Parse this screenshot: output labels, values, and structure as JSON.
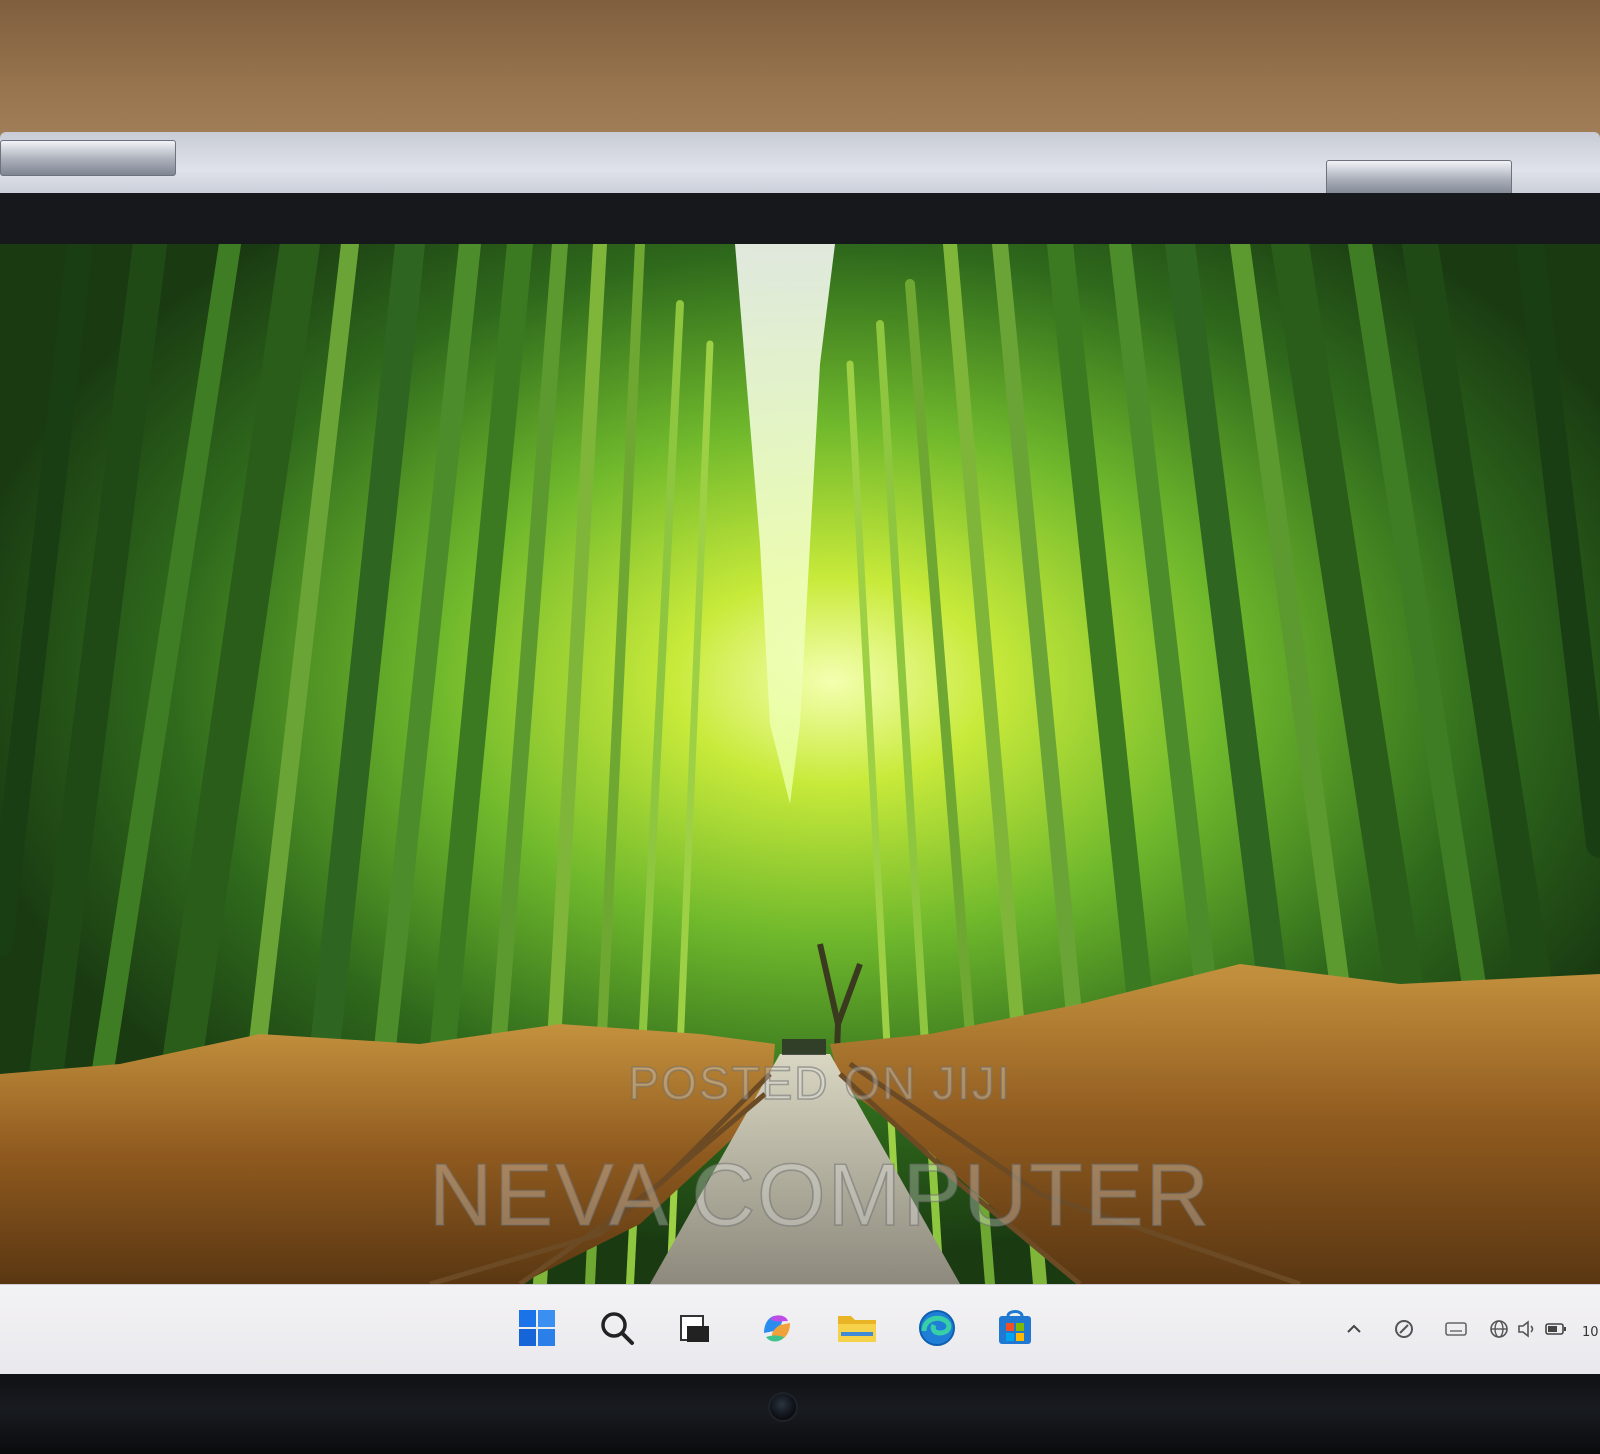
{
  "watermark": {
    "line1": "POSTED ON JIJI",
    "line2": "NEVA COMPUTER"
  },
  "taskbar": {
    "apps": [
      {
        "name": "start",
        "icon": "windows-logo-icon"
      },
      {
        "name": "search",
        "icon": "search-icon"
      },
      {
        "name": "task-view",
        "icon": "task-view-icon"
      },
      {
        "name": "copilot",
        "icon": "copilot-icon"
      },
      {
        "name": "file-explorer",
        "icon": "folder-icon"
      },
      {
        "name": "edge",
        "icon": "edge-browser-icon"
      },
      {
        "name": "store",
        "icon": "store-icon"
      }
    ],
    "tray": [
      {
        "name": "hidden-icons",
        "icon": "chevron-up-icon"
      },
      {
        "name": "pen-menu",
        "icon": "pen-icon"
      },
      {
        "name": "touch-keyboard",
        "icon": "keyboard-icon"
      },
      {
        "name": "network",
        "icon": "globe-icon"
      },
      {
        "name": "volume",
        "icon": "speaker-icon"
      },
      {
        "name": "battery",
        "icon": "battery-icon"
      }
    ],
    "clock_partial": "10"
  },
  "colors": {
    "taskbar_bg": "#f1f0f3",
    "accent_blue": "#1a73e8",
    "bamboo_green": "#6fb82c"
  }
}
